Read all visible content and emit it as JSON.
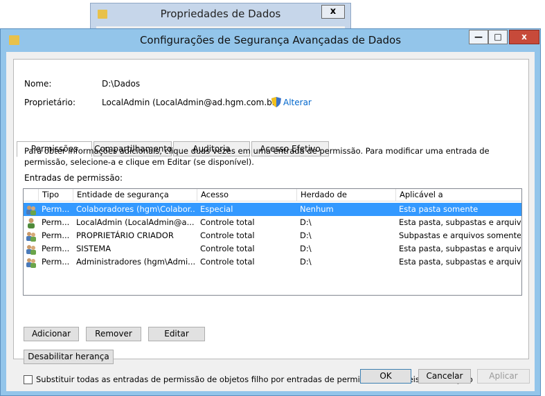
{
  "bg_window": {
    "title": "Propriedades de Dados",
    "close": "x"
  },
  "window": {
    "title": "Configurações de Segurança Avançadas de Dados",
    "minimize": "—",
    "maximize": "□",
    "close": "x"
  },
  "info": {
    "name_label": "Nome:",
    "name_value": "D:\\Dados",
    "owner_label": "Proprietário:",
    "owner_value": "LocalAdmin (LocalAdmin@ad.hgm.com.br)",
    "change_link": "Alterar"
  },
  "tabs": [
    {
      "label": "Permissões",
      "active": true
    },
    {
      "label": "Compartilhamento",
      "active": false
    },
    {
      "label": "Auditoria",
      "active": false
    },
    {
      "label": "Acesso Efetivo",
      "active": false
    }
  ],
  "description": "Para obter informações adicionais, clique duas vezes em uma entrada de permissão. Para modificar uma entrada de permissão, selecione-a e clique em Editar (se disponível).",
  "entries_label": "Entradas de permissão:",
  "table": {
    "headers": [
      "Tipo",
      "Entidade de segurança",
      "Acesso",
      "Herdado de",
      "Aplicável a"
    ],
    "rows": [
      {
        "tipo": "Perm...",
        "entidade": "Colaboradores (hgm\\Colabor...",
        "acesso": "Especial",
        "herdado": "Nenhum",
        "aplicavel": "Esta pasta somente",
        "icon": "group-icon"
      },
      {
        "tipo": "Perm...",
        "entidade": "LocalAdmin (LocalAdmin@a...",
        "acesso": "Controle total",
        "herdado": "D:\\",
        "aplicavel": "Esta pasta, subpastas e arquivos",
        "icon": "user-icon"
      },
      {
        "tipo": "Perm...",
        "entidade": "PROPRIETÁRIO CRIADOR",
        "acesso": "Controle total",
        "herdado": "D:\\",
        "aplicavel": "Subpastas e arquivos somente",
        "icon": "group-icon"
      },
      {
        "tipo": "Perm...",
        "entidade": "SISTEMA",
        "acesso": "Controle total",
        "herdado": "D:\\",
        "aplicavel": "Esta pasta, subpastas e arquivos",
        "icon": "group-icon"
      },
      {
        "tipo": "Perm...",
        "entidade": "Administradores (hgm\\Admi...",
        "acesso": "Controle total",
        "herdado": "D:\\",
        "aplicavel": "Esta pasta, subpastas e arquivos",
        "icon": "group-icon"
      }
    ]
  },
  "buttons": {
    "add": "Adicionar",
    "remove": "Remover",
    "edit": "Editar",
    "disable_inheritance": "Desabilitar herança",
    "ok": "OK",
    "cancel": "Cancelar",
    "apply": "Aplicar"
  },
  "replace_checkbox_label": "Substituir todas as entradas de permissão de objetos filho por entradas de permissão herdáveis desse objeto",
  "colors": {
    "selection": "#3399ff",
    "title_bar": "#93c5ea",
    "close_button": "#c74a3a",
    "link": "#0066cc"
  }
}
